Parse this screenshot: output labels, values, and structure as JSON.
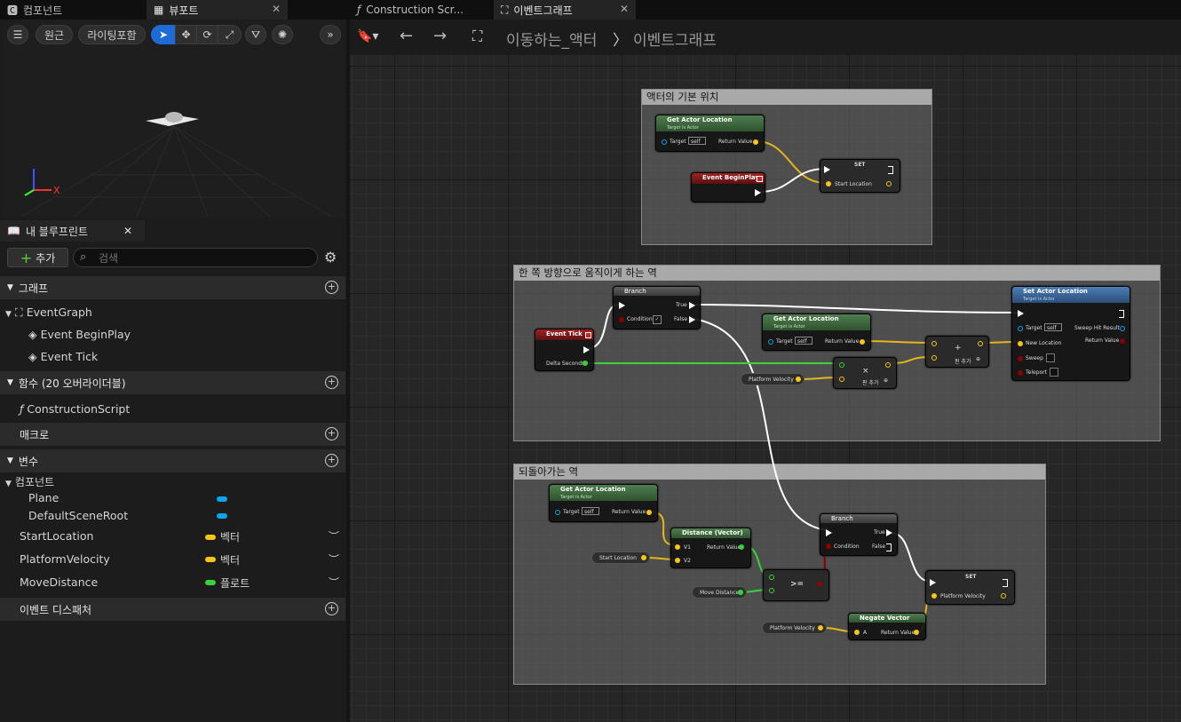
{
  "tabs": {
    "components": "컴포넌트",
    "viewport": "뷰포트",
    "construction": "Construction Scr...",
    "eventgraph": "이벤트그래프"
  },
  "viewport_toolbar": {
    "perspective": "원근",
    "lit": "라이팅포함"
  },
  "breadcrumb": {
    "actor": "이동하는_액터",
    "separator": "〉",
    "graph": "이벤트그래프"
  },
  "my_blueprint": {
    "tab": "내 블루프린트",
    "add": "추가",
    "search_placeholder": "검색",
    "graph_section": "그래프",
    "event_graph": "EventGraph",
    "event_beginplay": "Event BeginPlay",
    "event_tick": "Event Tick",
    "functions_section": "함수 (20 오버라이더블)",
    "construction_script": "ConstructionScript",
    "macros_section": "매크로",
    "variables_section": "변수",
    "components_group": "컴포넌트",
    "plane": "Plane",
    "default_scene_root": "DefaultSceneRoot",
    "start_location": "StartLocation",
    "start_location_type": "벡터",
    "platform_velocity": "PlatformVelocity",
    "platform_velocity_type": "벡터",
    "move_distance": "MoveDistance",
    "move_distance_type": "플로트",
    "dispatchers_section": "이벤트 디스패처"
  },
  "colors": {
    "vector_pin": "#f5c518",
    "float_pin": "#38d23a",
    "object_pin": "#0aa4f0",
    "bool_pin": "#8a0000",
    "function_header": "#3c6b3c",
    "event_header": "#8a1a1a",
    "flow_header": "#555555",
    "set_actor_header": "#3e6a9a"
  },
  "graph": {
    "comment1": "액터의 기본 위치",
    "comment2": "한 쪽 방향으로 움직이게 하는 역",
    "comment3": "되돌아가는 역",
    "get_actor_location": "Get Actor Location",
    "target_is_actor": "Target is Actor",
    "target": "Target",
    "self": "self",
    "return_value": "Return Value",
    "set": "SET",
    "start_location": "Start Location",
    "event_beginplay": "Event BeginPlay",
    "branch": "Branch",
    "true": "True",
    "false": "False",
    "condition": "Condition",
    "event_tick": "Event Tick",
    "delta_seconds": "Delta Seconds",
    "platform_velocity": "Platform Velocity",
    "add_pin": "핀 추가",
    "set_actor_location": "Set Actor Location",
    "new_location": "New Location",
    "sweep": "Sweep",
    "teleport": "Teleport",
    "sweep_hit_result": "Sweep Hit Result",
    "distance_vector": "Distance (Vector)",
    "v1": "V1",
    "v2": "V2",
    "start_location_var": "Start Location",
    "move_distance": "Move Distance",
    "gte": ">=",
    "negate_vector": "Negate Vector",
    "a": "A",
    "multiply": "×",
    "plus": "+"
  }
}
